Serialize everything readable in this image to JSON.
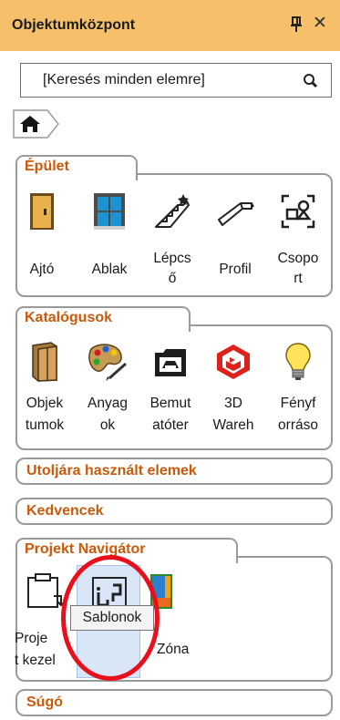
{
  "header": {
    "title": "Objektumközpont"
  },
  "search": {
    "placeholder": "[Keresés minden elemre]"
  },
  "sections": {
    "epulet": {
      "title": "Épület",
      "items": [
        {
          "label_lines": [
            "Ajtó",
            ""
          ],
          "icon": "door-icon"
        },
        {
          "label_lines": [
            "Ablak",
            ""
          ],
          "icon": "window-icon"
        },
        {
          "label_lines": [
            "Lépcs",
            "ő"
          ],
          "icon": "stairs-icon"
        },
        {
          "label_lines": [
            "Profil",
            ""
          ],
          "icon": "profile-icon"
        },
        {
          "label_lines": [
            "Csopo",
            "rt"
          ],
          "icon": "group-icon"
        }
      ]
    },
    "katalogusok": {
      "title": "Katalógusok",
      "items": [
        {
          "label_lines": [
            "Objek",
            "tumok"
          ],
          "icon": "wardrobe-icon"
        },
        {
          "label_lines": [
            "Anyag",
            "ok"
          ],
          "icon": "palette-icon"
        },
        {
          "label_lines": [
            "Bemut",
            "atóter"
          ],
          "icon": "showroom-icon"
        },
        {
          "label_lines": [
            "3D",
            "Wareh"
          ],
          "icon": "3d-warehouse-icon"
        },
        {
          "label_lines": [
            "Fényf",
            "orráso"
          ],
          "icon": "lightbulb-icon"
        }
      ]
    },
    "utoljara": {
      "title": "Utoljára használt elemek"
    },
    "kedvencek": {
      "title": "Kedvencek"
    },
    "navigator": {
      "title": "Projekt Navigátor",
      "items": [
        {
          "label_lines": [
            "Proje",
            "t kezel"
          ],
          "icon": "project-management-icon"
        },
        {
          "label_lines": [
            "",
            ""
          ],
          "icon": "templates-icon"
        },
        {
          "label_lines": [
            "Zóna",
            ""
          ],
          "icon": "zone-icon"
        }
      ],
      "tooltip": "Sablonok"
    },
    "sugo": {
      "title": "Súgó"
    }
  },
  "colors": {
    "header_bg": "#f6c06b",
    "section_title": "#c85a0c",
    "highlight_ring": "#e8101c"
  }
}
